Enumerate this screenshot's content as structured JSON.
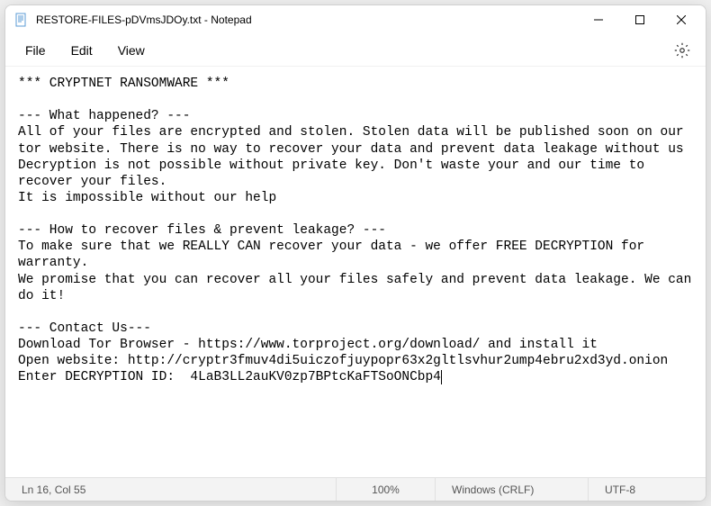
{
  "window": {
    "title": "RESTORE-FILES-pDVmsJDOy.txt - Notepad"
  },
  "menu": {
    "file": "File",
    "edit": "Edit",
    "view": "View"
  },
  "content": {
    "text": "*** CRYPTNET RANSOMWARE ***\n\n--- What happened? ---\nAll of your files are encrypted and stolen. Stolen data will be published soon on our tor website. There is no way to recover your data and prevent data leakage without us\nDecryption is not possible without private key. Don't waste your and our time to recover your files.\nIt is impossible without our help\n\n--- How to recover files & prevent leakage? ---\nTo make sure that we REALLY CAN recover your data - we offer FREE DECRYPTION for warranty.\nWe promise that you can recover all your files safely and prevent data leakage. We can do it!\n\n--- Contact Us---\nDownload Tor Browser - https://www.torproject.org/download/ and install it\nOpen website: http://cryptr3fmuv4di5uiczofjuypopr63x2gltlsvhur2ump4ebru2xd3yd.onion\nEnter DECRYPTION ID:  4LaB3LL2auKV0zp7BPtcKaFTSoONCbp4"
  },
  "status": {
    "position": "Ln 16, Col 55",
    "zoom": "100%",
    "lineending": "Windows (CRLF)",
    "encoding": "UTF-8"
  }
}
